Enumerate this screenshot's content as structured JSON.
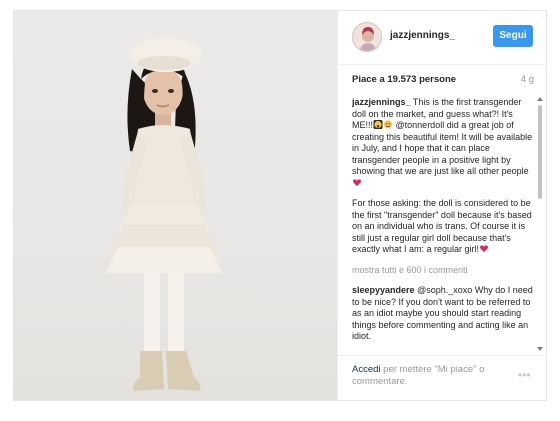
{
  "post": {
    "username": "jazzjennings_",
    "follow_label": "Segui",
    "likes_text": "Piace a 19.573 persone",
    "time_ago": "4 g",
    "caption": {
      "username": "jazzjennings_",
      "part1": "This is the first transgender doll on the market, and guess what?! It's ME!!!",
      "mention": "@tonnerdoll",
      "part2": "did a great job of creating this beautiful item! It will be available in July, and I hope that it can place transgender people in a positive light by showing that we are just like all other people",
      "part3": "For those asking: the doll is considered to be the first \"transgender\" doll because it's based on an individual who is trans. Of course it is still just a regular girl doll because that's exactly what I am: a regular girl!"
    },
    "view_all_comments": "mostra tutti e 600 i commenti",
    "comment": {
      "username": "sleepyyandere",
      "text": "@soph._xoxo Why do I need to be nice? If you don't want to be referred to as an idiot maybe you should start reading things before commenting and acting like an idiot."
    },
    "login_prompt": {
      "link": "Accedi",
      "rest": "per mettere \"Mi piace\" o commentare."
    },
    "more_options": "•••",
    "icons": {
      "emoji_1": "scream-emoji-icon",
      "emoji_2": "heart-eyes-emoji-icon",
      "emoji_3": "red-heart-icon",
      "emoji_4": "red-heart-icon",
      "avatar": "profile-avatar",
      "more": "more-options-icon"
    },
    "colors": {
      "follow_button": "#3897f0",
      "muted_text": "#999999",
      "link": "#003569",
      "heart": "#e0245e"
    }
  }
}
